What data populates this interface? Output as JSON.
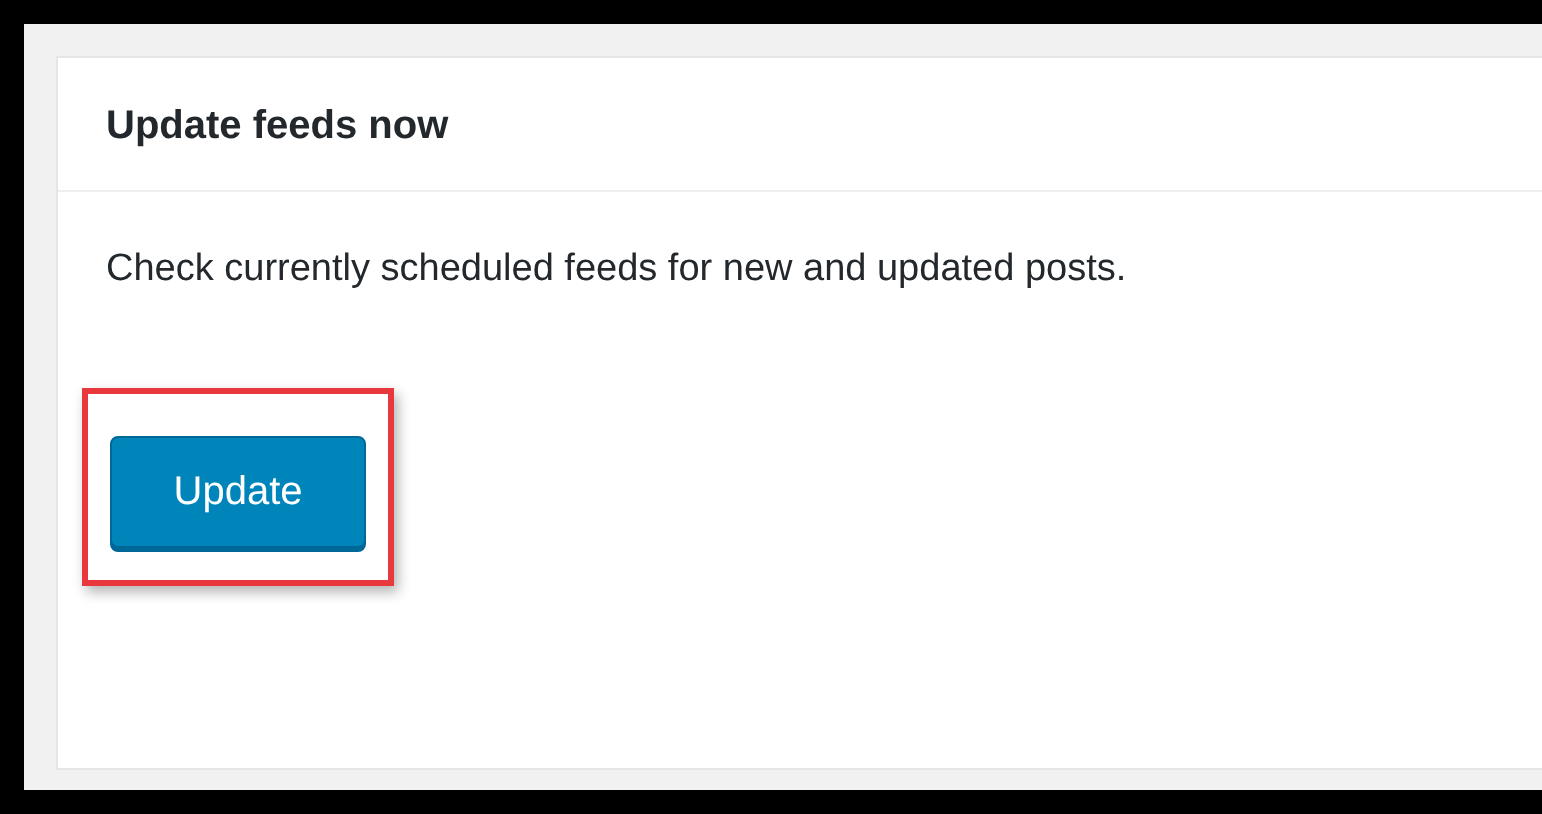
{
  "panel": {
    "title": "Update feeds now",
    "description": "Check currently scheduled feeds for new and updated posts.",
    "button": "Update",
    "highlighted": true
  }
}
